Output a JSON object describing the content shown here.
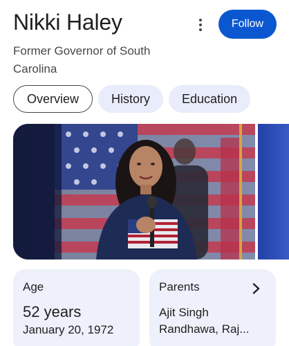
{
  "header": {
    "title": "Nikki Haley",
    "subtitle": "Former Governor of South Carolina",
    "follow_label": "Follow",
    "more_icon": "more-vert-icon"
  },
  "tabs": [
    {
      "label": "Overview",
      "active": true
    },
    {
      "label": "History",
      "active": false
    },
    {
      "label": "Education",
      "active": false
    }
  ],
  "cards": {
    "age": {
      "label": "Age",
      "value": "52 years",
      "detail": "January 20, 1972"
    },
    "parents": {
      "label": "Parents",
      "value": "Ajit Singh Randhawa, Raj...",
      "chevron_icon": "chevron-right-icon"
    }
  },
  "colors": {
    "accent": "#0b57d0",
    "chip_bg": "#e9ecfa",
    "card_bg": "#eef0fb"
  }
}
